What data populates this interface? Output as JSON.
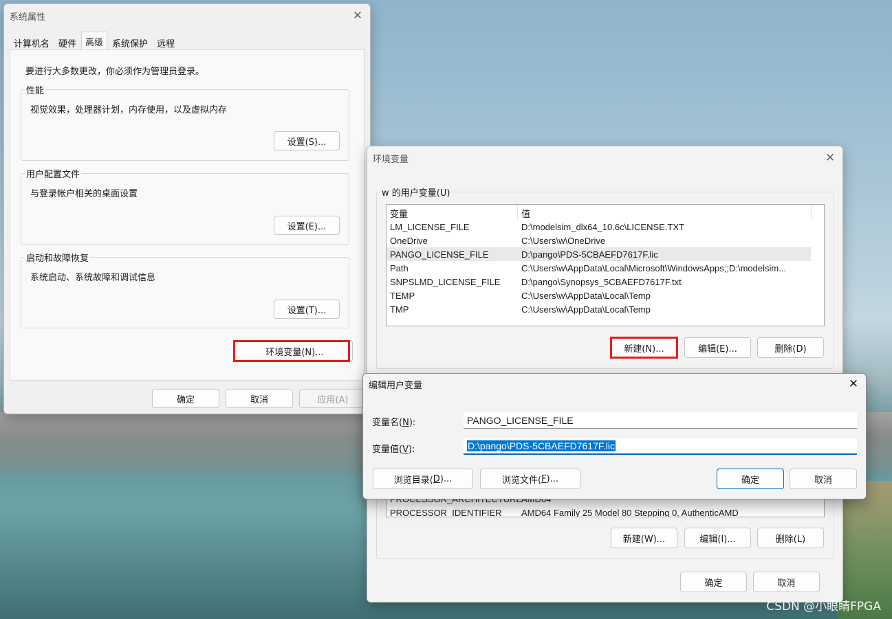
{
  "system_properties": {
    "title": "系统属性",
    "tabs": [
      {
        "label": "计算机名"
      },
      {
        "label": "硬件"
      },
      {
        "label": "高级"
      },
      {
        "label": "系统保护"
      },
      {
        "label": "远程"
      }
    ],
    "admin_note": "要进行大多数更改，你必须作为管理员登录。",
    "performance": {
      "title": "性能",
      "desc": "视觉效果，处理器计划，内存使用，以及虚拟内存",
      "button": "设置(S)..."
    },
    "user_profiles": {
      "title": "用户配置文件",
      "desc": "与登录帐户相关的桌面设置",
      "button": "设置(E)..."
    },
    "startup_recovery": {
      "title": "启动和故障恢复",
      "desc": "系统启动、系统故障和调试信息",
      "button": "设置(T)..."
    },
    "env_button": "环境变量(N)...",
    "ok": "确定",
    "cancel": "取消",
    "apply": "应用(A)"
  },
  "env_vars": {
    "title": "环境变量",
    "user_group": "w 的用户变量(U)",
    "columns": {
      "name": "变量",
      "value": "值"
    },
    "user_rows": [
      {
        "name": "LM_LICENSE_FILE",
        "value": "D:\\modelsim_dlx64_10.6c\\LICENSE.TXT"
      },
      {
        "name": "OneDrive",
        "value": "C:\\Users\\w\\OneDrive"
      },
      {
        "name": "PANGO_LICENSE_FILE",
        "value": "D:\\pango\\PDS-5CBAEFD7617F.lic"
      },
      {
        "name": "Path",
        "value": "C:\\Users\\w\\AppData\\Local\\Microsoft\\WindowsApps;;D:\\modelsim..."
      },
      {
        "name": "SNPSLMD_LICENSE_FILE",
        "value": "D:\\pango\\Synopsys_5CBAEFD7617F.txt"
      },
      {
        "name": "TEMP",
        "value": "C:\\Users\\w\\AppData\\Local\\Temp"
      },
      {
        "name": "TMP",
        "value": "C:\\Users\\w\\AppData\\Local\\Temp"
      }
    ],
    "user_buttons": {
      "new": "新建(N)...",
      "edit": "编辑(E)...",
      "delete": "删除(D)"
    },
    "system_rows_visible": [
      {
        "name": "PROCESSOR_ARCHITECTURE",
        "value": "AMD64"
      },
      {
        "name": "PROCESSOR_IDENTIFIER",
        "value": "AMD64 Family 25 Model 80 Stepping 0, AuthenticAMD"
      }
    ],
    "system_buttons": {
      "new": "新建(W)...",
      "edit": "编辑(I)...",
      "delete": "删除(L)"
    },
    "ok": "确定",
    "cancel": "取消"
  },
  "edit_dialog": {
    "title": "编辑用户变量",
    "name_label": "变量名(",
    "name_key": "N",
    "name_suffix": "):",
    "name_value": "PANGO_LICENSE_FILE",
    "value_label": "变量值(",
    "value_key": "V",
    "value_suffix": "):",
    "value_value": "D:\\pango\\PDS-5CBAEFD7617F.lic",
    "browse_dir_prefix": "浏览目录(",
    "browse_dir_key": "D",
    "browse_dir_suffix": ")...",
    "browse_file_prefix": "浏览文件(",
    "browse_file_key": "F",
    "browse_file_suffix": ")...",
    "ok": "确定",
    "cancel": "取消"
  },
  "watermark": "CSDN @小眼睛FPGA",
  "colors": {
    "highlight": "#e0201b",
    "accent": "#0067c0",
    "selection": "#0078d4"
  }
}
